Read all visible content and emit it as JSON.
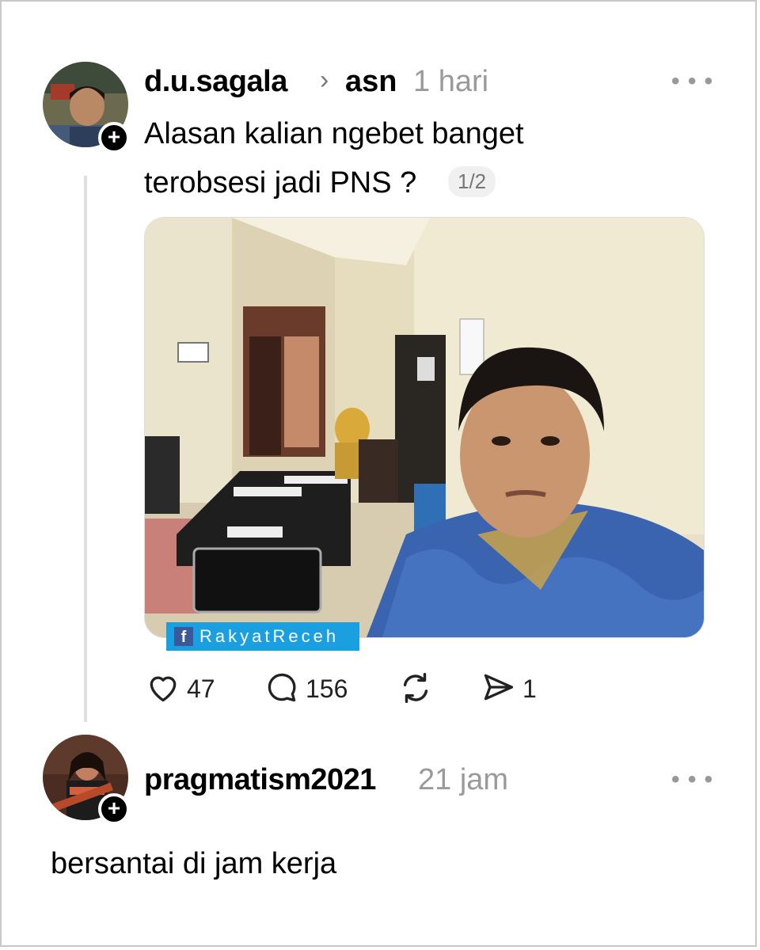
{
  "post": {
    "username": "d.u.sagala",
    "chevron": "›",
    "topic": "asn",
    "time": "1 hari",
    "more_icon": "more-horizontal-icon",
    "text_line1": "Alasan kalian ngebet banget",
    "text_line2": "terobsesi jadi PNS ?",
    "pager": "1/2",
    "watermark": "RakyatReceh",
    "actions": {
      "likes": "47",
      "comments": "156",
      "shares": "1"
    }
  },
  "reply": {
    "username": "pragmatism2021",
    "time": "21 jam",
    "text": "bersantai di jam kerja"
  },
  "colors": {
    "watermark_bg": "#1a9fe0",
    "muted": "#9a9a9a",
    "thread_line": "#e0e0e0"
  }
}
